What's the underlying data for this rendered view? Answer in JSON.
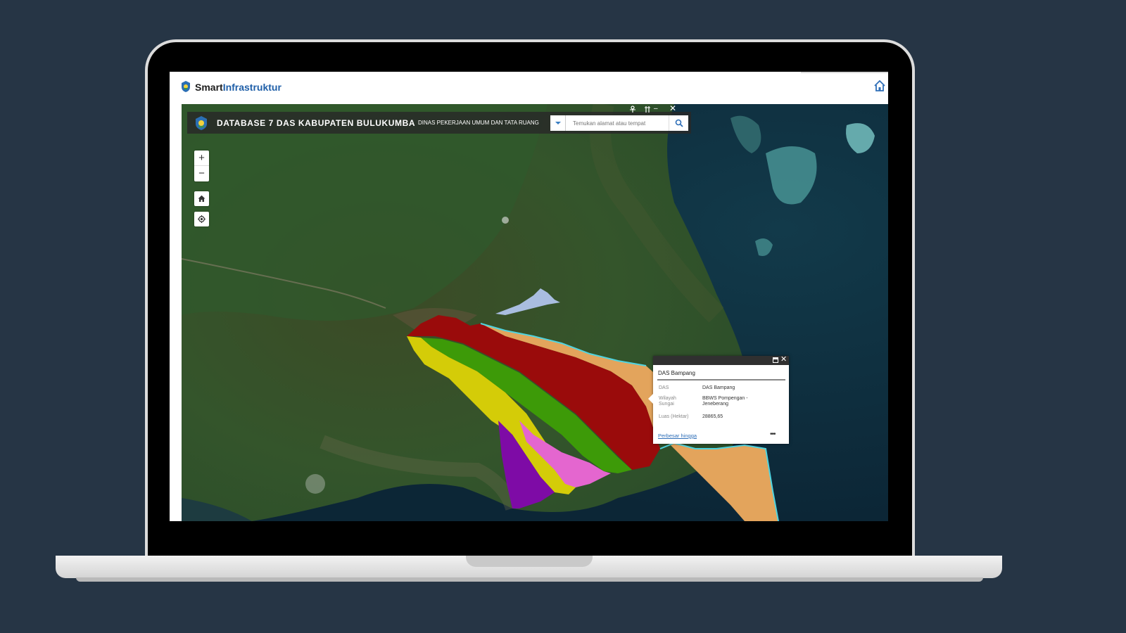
{
  "app": {
    "brand_part1": "Smart",
    "brand_part2": "Infrastruktur"
  },
  "map_header": {
    "title": "DATABASE 7 DAS KABUPATEN BULUKUMBA",
    "subtitle": "DINAS PEKERJAAN UMUM DAN TATA RUANG",
    "search_placeholder": "Temukan alamat atau tempat"
  },
  "window_controls": {
    "minimize": "–",
    "close": "✕"
  },
  "map_controls": {
    "zoom_in": "+",
    "zoom_out": "−"
  },
  "popup": {
    "title": "DAS Bampang",
    "fields": [
      {
        "label": "DAS",
        "value": "DAS Bampang"
      },
      {
        "label": "Wilayah Sungai",
        "value": "BBWS Pompengan - Jeneberang"
      },
      {
        "label": "Luas (Hektar)",
        "value": "28865,65"
      }
    ],
    "link": "Perbesar hingga",
    "more": "•••",
    "close": "✕"
  },
  "watershed_colors": {
    "red": "#9a0b0b",
    "green": "#3d9a08",
    "yellow": "#d4cc08",
    "pink": "#e466cf",
    "purple": "#7e0ba6",
    "orange": "#e3a45c",
    "lightblue": "#a9bde0"
  },
  "icons": {
    "home": "home-icon",
    "search": "search-icon",
    "locate": "locate-icon"
  }
}
